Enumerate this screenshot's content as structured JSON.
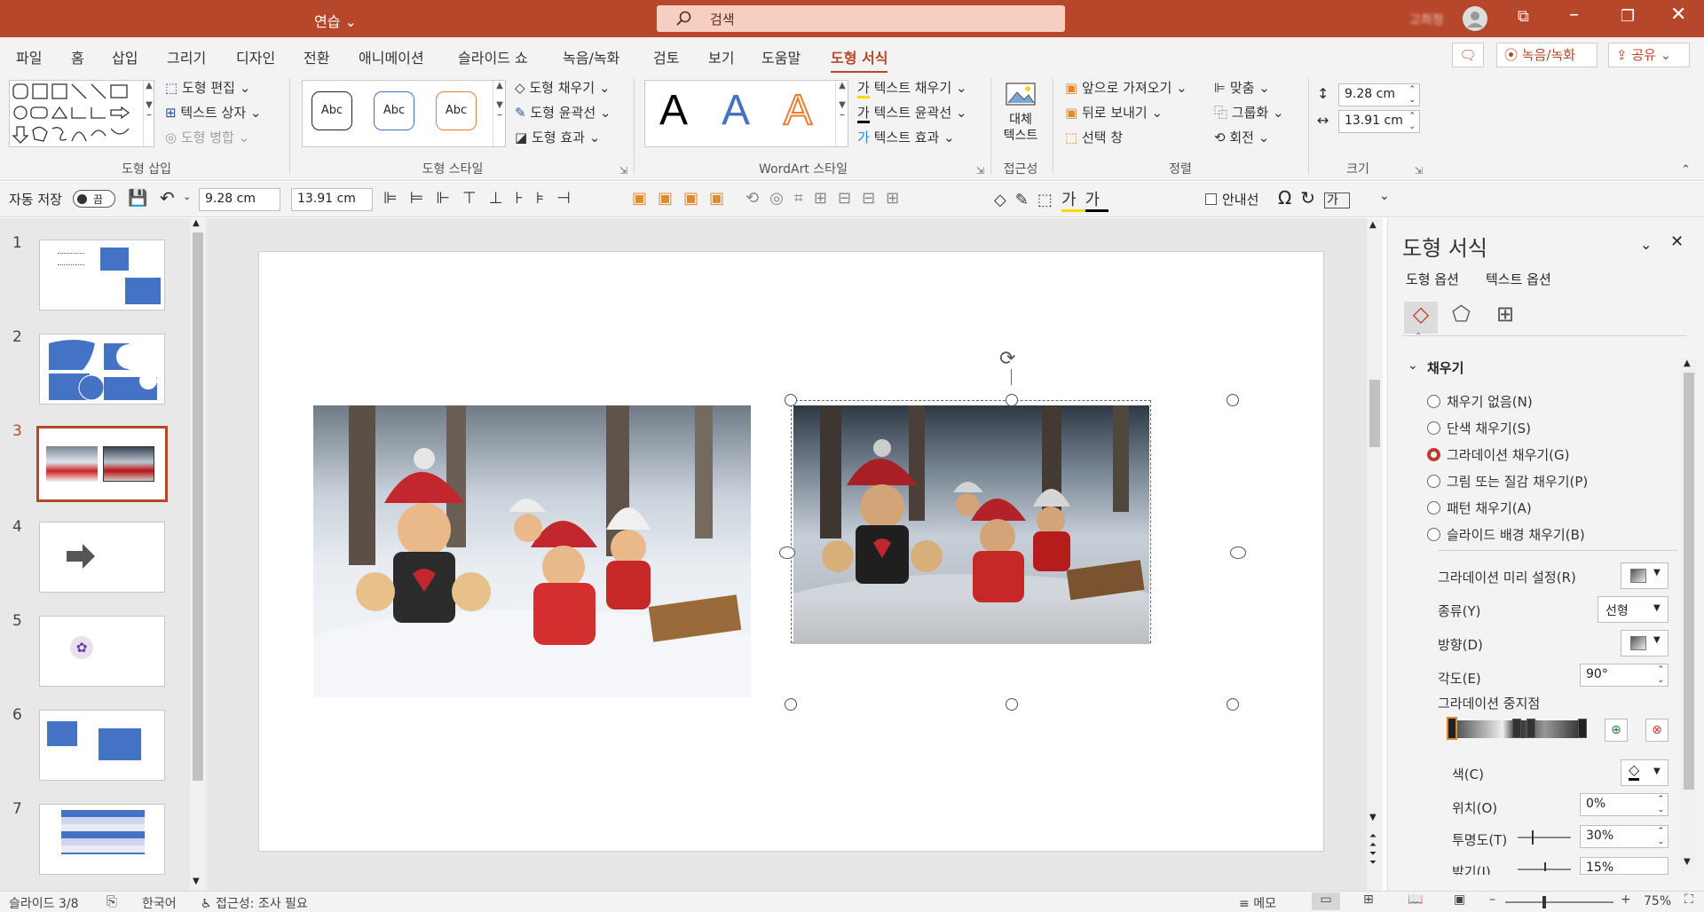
{
  "titlebar": {
    "doc_title": "연습",
    "search_placeholder": "검색",
    "account_name": "고희정",
    "colors": {
      "accent": "#b7472a"
    }
  },
  "ribbon_tabs": [
    "파일",
    "홈",
    "삽입",
    "그리기",
    "디자인",
    "전환",
    "애니메이션",
    "슬라이드 쇼",
    "녹음/녹화",
    "검토",
    "보기",
    "도움말",
    "도형 서식"
  ],
  "active_tab": "도형 서식",
  "ribbon_right": {
    "comment_icon": "comment-icon",
    "record": "녹음/녹화",
    "share": "공유"
  },
  "ribbon": {
    "insert_shapes": {
      "edit_shape": "도형 편집",
      "text_box": "텍스트 상자",
      "merge_shapes": "도형 병합",
      "label": "도형 삽입"
    },
    "shape_styles": {
      "samples": [
        "Abc",
        "Abc",
        "Abc"
      ],
      "fill": "도형 채우기",
      "outline": "도형 윤곽선",
      "effects": "도형 효과",
      "label": "도형 스타일"
    },
    "wordart": {
      "samples": [
        "A",
        "A",
        "A"
      ],
      "text_fill": "텍스트 채우기",
      "text_outline": "텍스트 윤곽선",
      "text_effects": "텍스트 효과",
      "label": "WordArt 스타일"
    },
    "accessibility": {
      "alt_text_line1": "대체",
      "alt_text_line2": "텍스트",
      "label": "접근성"
    },
    "arrange": {
      "bring_forward": "앞으로 가져오기",
      "send_backward": "뒤로 보내기",
      "selection_pane": "선택 창",
      "align": "맞춤",
      "group": "그룹화",
      "rotate": "회전",
      "label": "정렬"
    },
    "size": {
      "height": "9.28 cm",
      "width": "13.91 cm",
      "label": "크기"
    }
  },
  "qat": {
    "autosave": "자동 저장",
    "autosave_state": "끔",
    "height": "9.28 cm",
    "width": "13.91 cm",
    "guides": "안내선"
  },
  "slides": [
    {
      "num": "1"
    },
    {
      "num": "2"
    },
    {
      "num": "3"
    },
    {
      "num": "4"
    },
    {
      "num": "5"
    },
    {
      "num": "6"
    },
    {
      "num": "7"
    }
  ],
  "current_slide": "3",
  "format_pane": {
    "title": "도형 서식",
    "tab_shape": "도형 옵션",
    "tab_text": "텍스트 옵션",
    "section": "채우기",
    "fill_options": [
      "채우기 없음(N)",
      "단색 채우기(S)",
      "그라데이션 채우기(G)",
      "그림 또는 질감 채우기(P)",
      "패턴 채우기(A)",
      "슬라이드 배경 채우기(B)"
    ],
    "selected_fill": "그라데이션 채우기(G)",
    "preset_label": "그라데이션 미리 설정(R)",
    "type_label": "종류(Y)",
    "type_value": "선형",
    "direction_label": "방향(D)",
    "angle_label": "각도(E)",
    "angle_value": "90°",
    "stops_label": "그라데이션 중지점",
    "color_label": "색(C)",
    "position_label": "위치(O)",
    "position_value": "0%",
    "transparency_label": "투명도(T)",
    "transparency_value": "30%",
    "brightness_label": "밝기(I)",
    "brightness_value": "15%"
  },
  "statusbar": {
    "slide_info": "슬라이드 3/8",
    "language": "한국어",
    "accessibility": "접근성: 조사 필요",
    "notes": "메모",
    "zoom": "75%"
  }
}
